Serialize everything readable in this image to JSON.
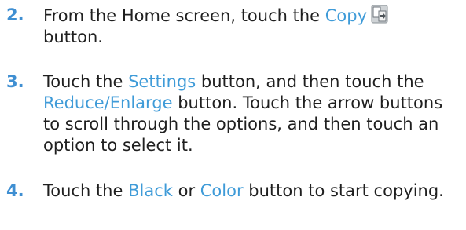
{
  "steps": [
    {
      "number": "2.",
      "parts": {
        "t1": "From the Home screen, touch the ",
        "h1": "Copy",
        "t2": "",
        "line2": "button."
      },
      "icon": "copy-icon"
    },
    {
      "number": "3.",
      "parts": {
        "t1": "Touch the ",
        "h1": "Settings",
        "t2": " button, and then touch the ",
        "h2": "Reduce/Enlarge",
        "t3": " button. Touch the arrow buttons to scroll through the options, and then touch an option to select it."
      }
    },
    {
      "number": "4.",
      "parts": {
        "t1": "Touch the ",
        "h1": "Black",
        "t2": " or ",
        "h2": "Color",
        "t3": " button to start copying."
      }
    }
  ],
  "colors": {
    "step_number": "#3f8fd2",
    "highlight": "#3f9bd8",
    "body_text": "#1f1f1f"
  }
}
